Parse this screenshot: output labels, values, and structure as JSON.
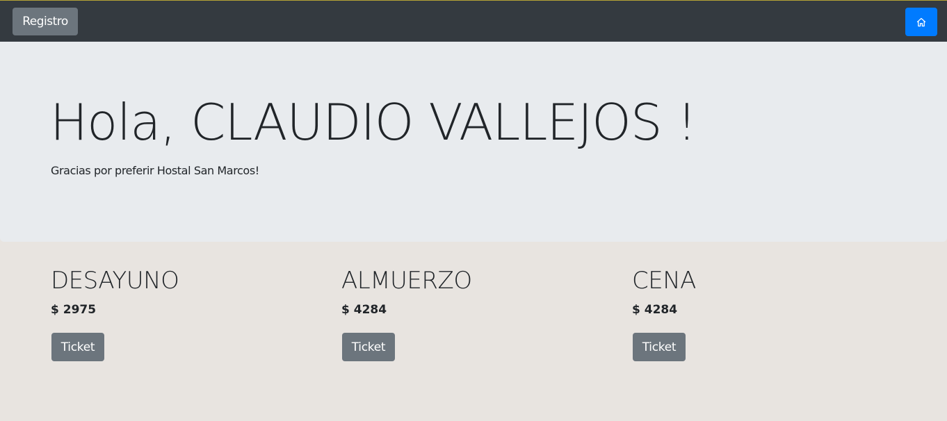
{
  "navbar": {
    "registro_label": "Registro",
    "home_icon": "home-icon"
  },
  "hero": {
    "title": "Hola, CLAUDIO VALLEJOS !",
    "subtitle": "Gracias por preferir Hostal San Marcos!"
  },
  "meals": [
    {
      "name": "DESAYUNO",
      "price": "$ 2975",
      "button_label": "Ticket"
    },
    {
      "name": "ALMUERZO",
      "price": "$ 4284",
      "button_label": "Ticket"
    },
    {
      "name": "CENA",
      "price": "$ 4284",
      "button_label": "Ticket"
    }
  ],
  "colors": {
    "navbar": "#343a40",
    "secondary_button": "#6c757d",
    "primary_button": "#007bff",
    "jumbotron": "#e8ebee",
    "page_background": "#e8e4e0"
  }
}
